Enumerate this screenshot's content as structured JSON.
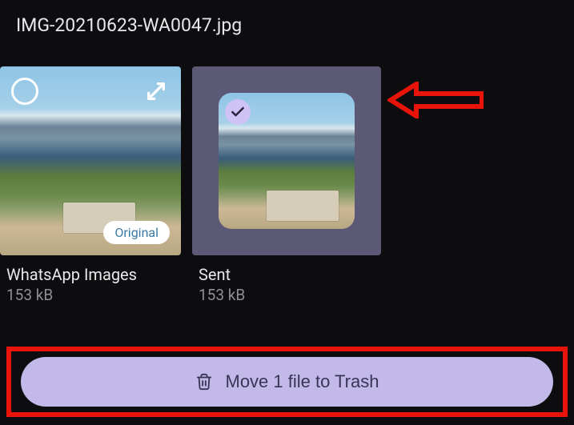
{
  "header": {
    "title": "IMG-20210623-WA0047.jpg"
  },
  "thumbnails": [
    {
      "title": "WhatsApp Images",
      "size": "153 kB",
      "badge": "Original",
      "selected": false
    },
    {
      "title": "Sent",
      "size": "153 kB",
      "selected": true
    }
  ],
  "action": {
    "label": "Move 1 file to Trash"
  },
  "annotations": {
    "arrow_color": "#e8140a",
    "highlight_color": "#e8140a"
  }
}
